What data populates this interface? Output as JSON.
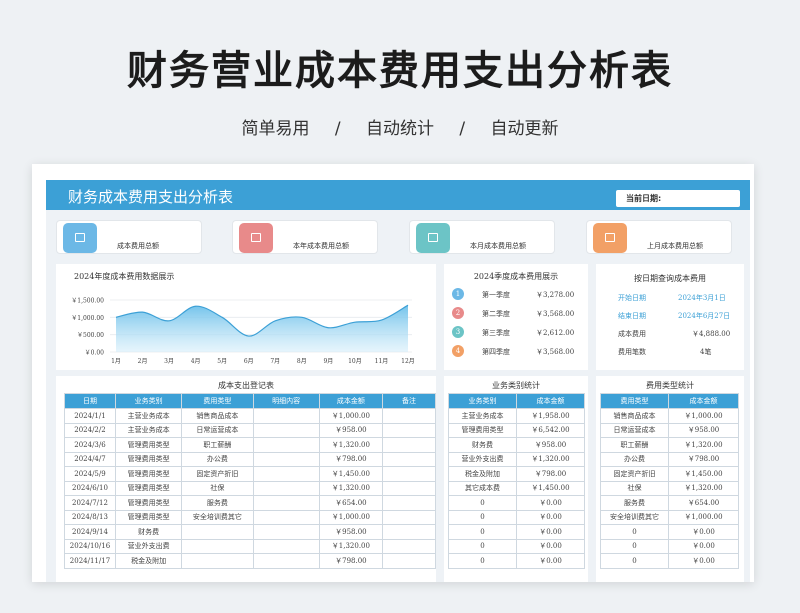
{
  "hero": {
    "title": "财务营业成本费用支出分析表",
    "sub": [
      "简单易用",
      "/",
      "自动统计",
      "/",
      "自动更新"
    ]
  },
  "sheet": {
    "title": "财务成本费用支出分析表",
    "date_label": "当前日期:"
  },
  "kpis": [
    {
      "label": "成本费用总额",
      "color": "#6cb8e6"
    },
    {
      "label": "本年成本费用总额",
      "color": "#e88a8a"
    },
    {
      "label": "本月成本费用总额",
      "color": "#6cc4c6"
    },
    {
      "label": "上月成本费用总额",
      "color": "#f2a066"
    }
  ],
  "chart": {
    "title": "2024年度成本费用数据展示",
    "y_ticks": [
      "￥1,500.00",
      "￥1,000.00",
      "￥500.00",
      "￥0.00"
    ],
    "months": [
      "1月",
      "2月",
      "3月",
      "4月",
      "5月",
      "6月",
      "7月",
      "8月",
      "9月",
      "10月",
      "11月",
      "12月"
    ]
  },
  "chart_data": {
    "type": "area",
    "title": "2024年度成本费用数据展示",
    "categories": [
      "1月",
      "2月",
      "3月",
      "4月",
      "5月",
      "6月",
      "7月",
      "8月",
      "9月",
      "10月",
      "11月",
      "12月"
    ],
    "values": [
      1000,
      1150,
      900,
      1320,
      1000,
      460,
      900,
      1000,
      700,
      860,
      920,
      1350
    ],
    "ylim": [
      0,
      1500
    ],
    "grid": true
  },
  "quarters": {
    "title": "2024季度成本费用展示",
    "rows": [
      {
        "n": "1",
        "name": "第一季度",
        "value": "￥3,278.00",
        "color": "#6cb8e6"
      },
      {
        "n": "2",
        "name": "第二季度",
        "value": "￥3,568.00",
        "color": "#e88a8a"
      },
      {
        "n": "3",
        "name": "第三季度",
        "value": "￥2,612.00",
        "color": "#6cc4c6"
      },
      {
        "n": "4",
        "name": "第四季度",
        "value": "￥3,568.00",
        "color": "#f2a066"
      }
    ]
  },
  "datequery": {
    "title": "按日期查询成本费用",
    "rows": [
      {
        "k": "开始日期",
        "v": "2024年3月1日",
        "blue": true
      },
      {
        "k": "结束日期",
        "v": "2024年6月27日",
        "blue": true
      },
      {
        "k": "成本费用",
        "v": "￥4,888.00",
        "blue": false
      },
      {
        "k": "费用笔数",
        "v": "4笔",
        "blue": false
      }
    ]
  },
  "ledger": {
    "title": "成本支出登记表",
    "headers": [
      "日期",
      "业务类别",
      "费用类型",
      "明细内容",
      "成本金额",
      "备注"
    ],
    "rows": [
      [
        "2024/1/1",
        "主营业务成本",
        "销售商品成本",
        "",
        "￥1,000.00",
        ""
      ],
      [
        "2024/2/2",
        "主营业务成本",
        "日常运营成本",
        "",
        "￥958.00",
        ""
      ],
      [
        "2024/3/6",
        "管理费用类型",
        "职工薪酬",
        "",
        "￥1,320.00",
        ""
      ],
      [
        "2024/4/7",
        "管理费用类型",
        "办公费",
        "",
        "￥798.00",
        ""
      ],
      [
        "2024/5/9",
        "管理费用类型",
        "固定资产折旧",
        "",
        "￥1,450.00",
        ""
      ],
      [
        "2024/6/10",
        "管理费用类型",
        "社保",
        "",
        "￥1,320.00",
        ""
      ],
      [
        "2024/7/12",
        "管理费用类型",
        "服务费",
        "",
        "￥654.00",
        ""
      ],
      [
        "2024/8/13",
        "管理费用类型",
        "安全培训费其它",
        "",
        "￥1,000.00",
        ""
      ],
      [
        "2024/9/14",
        "财务费",
        "",
        "",
        "￥958.00",
        ""
      ],
      [
        "2024/10/16",
        "营业外支出费",
        "",
        "",
        "￥1,320.00",
        ""
      ],
      [
        "2024/11/17",
        "税金及附加",
        "",
        "",
        "￥798.00",
        ""
      ]
    ]
  },
  "bizstat": {
    "title": "业务类别统计",
    "headers": [
      "业务类别",
      "成本金额"
    ],
    "rows": [
      [
        "主营业务成本",
        "￥1,958.00"
      ],
      [
        "管理费用类型",
        "￥6,542.00"
      ],
      [
        "财务费",
        "￥958.00"
      ],
      [
        "营业外支出费",
        "￥1,320.00"
      ],
      [
        "税金及附加",
        "￥798.00"
      ],
      [
        "其它成本费",
        "￥1,450.00"
      ],
      [
        "0",
        "￥0.00"
      ],
      [
        "0",
        "￥0.00"
      ],
      [
        "0",
        "￥0.00"
      ],
      [
        "0",
        "￥0.00"
      ],
      [
        "0",
        "￥0.00"
      ]
    ]
  },
  "typestat": {
    "title": "费用类型统计",
    "headers": [
      "费用类型",
      "成本金额"
    ],
    "rows": [
      [
        "销售商品成本",
        "￥1,000.00"
      ],
      [
        "日常运营成本",
        "￥958.00"
      ],
      [
        "职工薪酬",
        "￥1,320.00"
      ],
      [
        "办公费",
        "￥798.00"
      ],
      [
        "固定资产折旧",
        "￥1,450.00"
      ],
      [
        "社保",
        "￥1,320.00"
      ],
      [
        "服务费",
        "￥654.00"
      ],
      [
        "安全培训费其它",
        "￥1,000.00"
      ],
      [
        "0",
        "￥0.00"
      ],
      [
        "0",
        "￥0.00"
      ],
      [
        "0",
        "￥0.00"
      ]
    ]
  }
}
